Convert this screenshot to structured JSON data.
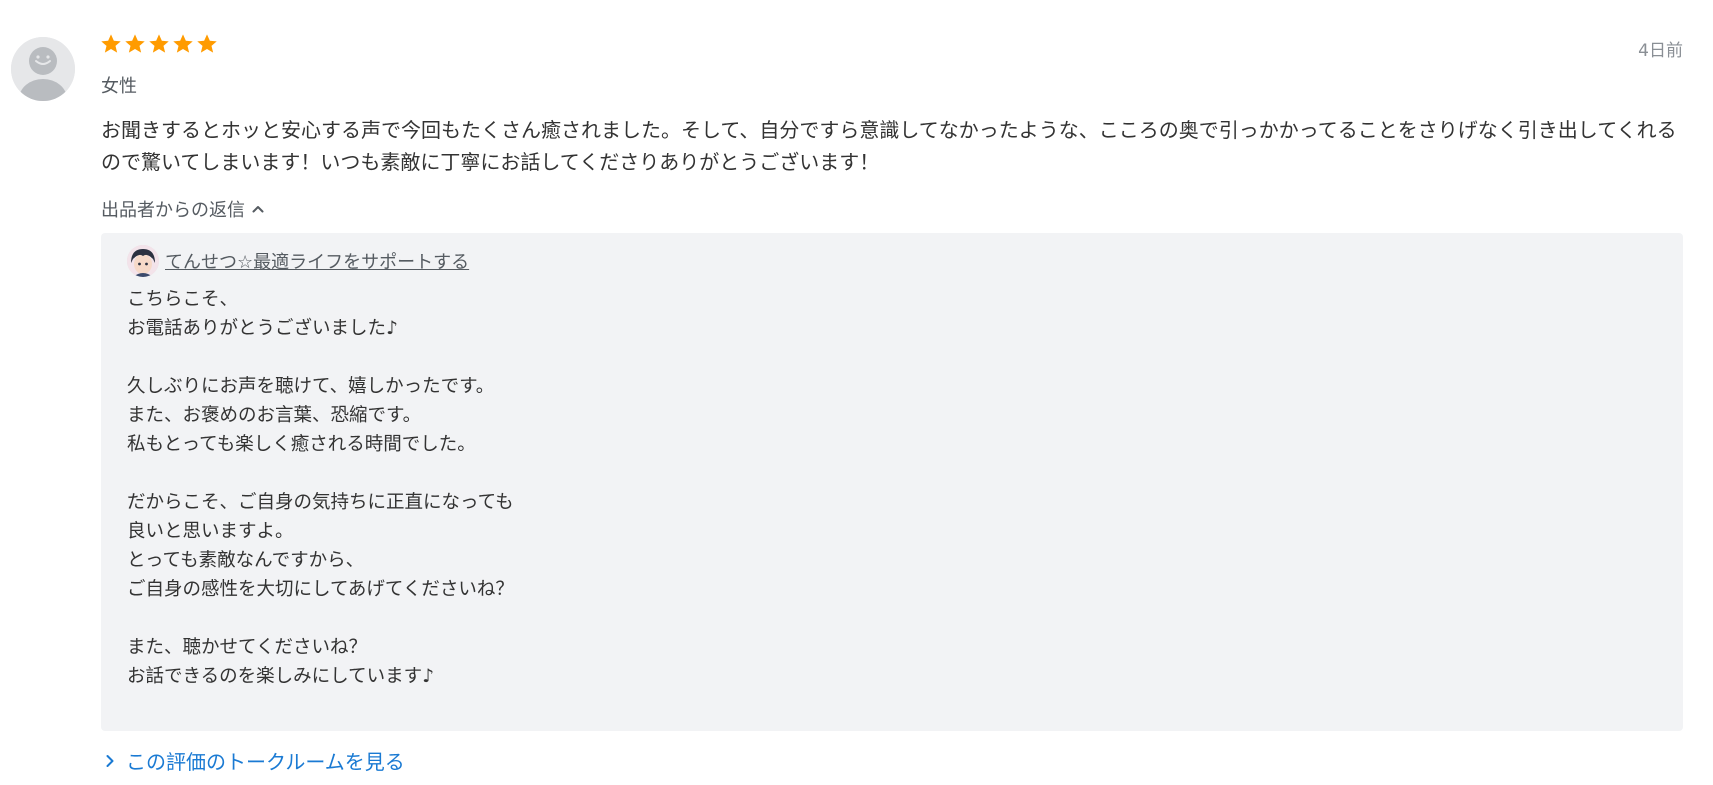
{
  "review": {
    "rating": 5,
    "rating_max": 5,
    "date": "4日前",
    "gender": "女性",
    "body": "お聞きするとホッと安心する声で今回もたくさん癒されました。そして、自分ですら意識してなかったような、こころの奥で引っかかってることをさりげなく引き出してくれるので驚いてしまいます！いつも素敵に丁寧にお話してくださりありがとうございます！",
    "star_color": "#ff9b00"
  },
  "reply": {
    "toggle_label": "出品者からの返信",
    "seller_name": "てんせつ☆最適ライフをサポートする",
    "text": "こちらこそ、\nお電話ありがとうございました♪\n\n久しぶりにお声を聴けて、嬉しかったです。\nまた、お褒めのお言葉、恐縮です。\n私もとっても楽しく癒される時間でした。\n\nだからこそ、ご自身の気持ちに正直になっても\n良いと思いますよ。\nとっても素敵なんですから、\nご自身の感性を大切にしてあげてくださいね？\n\nまた、聴かせてくださいね？\nお話できるのを楽しみにしています♪"
  },
  "talkroom_link": "この評価のトークルームを見る",
  "icons": {
    "avatar": "default-user-avatar-icon",
    "star": "star-icon",
    "toggle": "chevron-up-icon",
    "link": "chevron-right-icon"
  },
  "colors": {
    "link": "#1a7ad3",
    "reply_bg": "#f2f3f5"
  }
}
